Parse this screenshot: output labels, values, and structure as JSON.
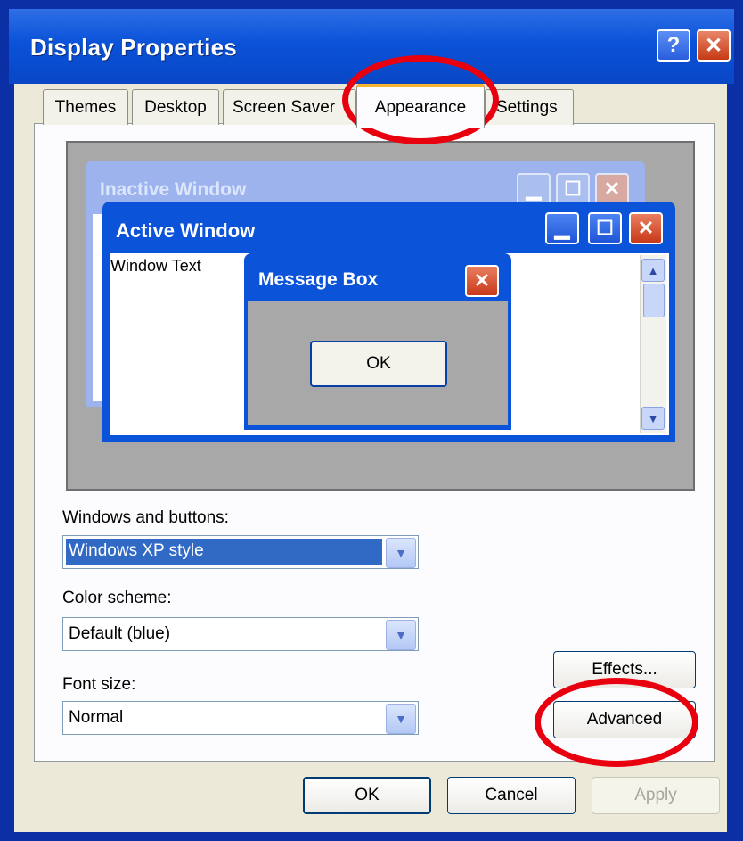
{
  "window": {
    "title": "Display Properties",
    "help_glyph": "?",
    "close_glyph": "✕"
  },
  "tabs": [
    {
      "label": "Themes"
    },
    {
      "label": "Desktop"
    },
    {
      "label": "Screen Saver"
    },
    {
      "label": "Appearance",
      "selected": true
    },
    {
      "label": "Settings"
    }
  ],
  "preview": {
    "inactive_title": "Inactive Window",
    "active_title": "Active Window",
    "window_text": "Window Text",
    "message_title": "Message Box",
    "message_ok": "OK",
    "min_glyph": "▁",
    "max_glyph": "☐",
    "close_glyph": "✕",
    "scroll_up": "▲",
    "scroll_down": "▼"
  },
  "form": {
    "windows_buttons_label": "Windows and buttons:",
    "windows_buttons_value": "Windows XP style",
    "color_scheme_label": "Color scheme:",
    "color_scheme_value": "Default (blue)",
    "font_size_label": "Font size:",
    "font_size_value": "Normal",
    "dropdown_glyph": "▼"
  },
  "buttons": {
    "effects": "Effects...",
    "advanced": "Advanced",
    "ok": "OK",
    "cancel": "Cancel",
    "apply": "Apply"
  },
  "annotations": {
    "highlight_color": "#e8000f",
    "highlighted": [
      "Appearance",
      "Advanced"
    ]
  }
}
